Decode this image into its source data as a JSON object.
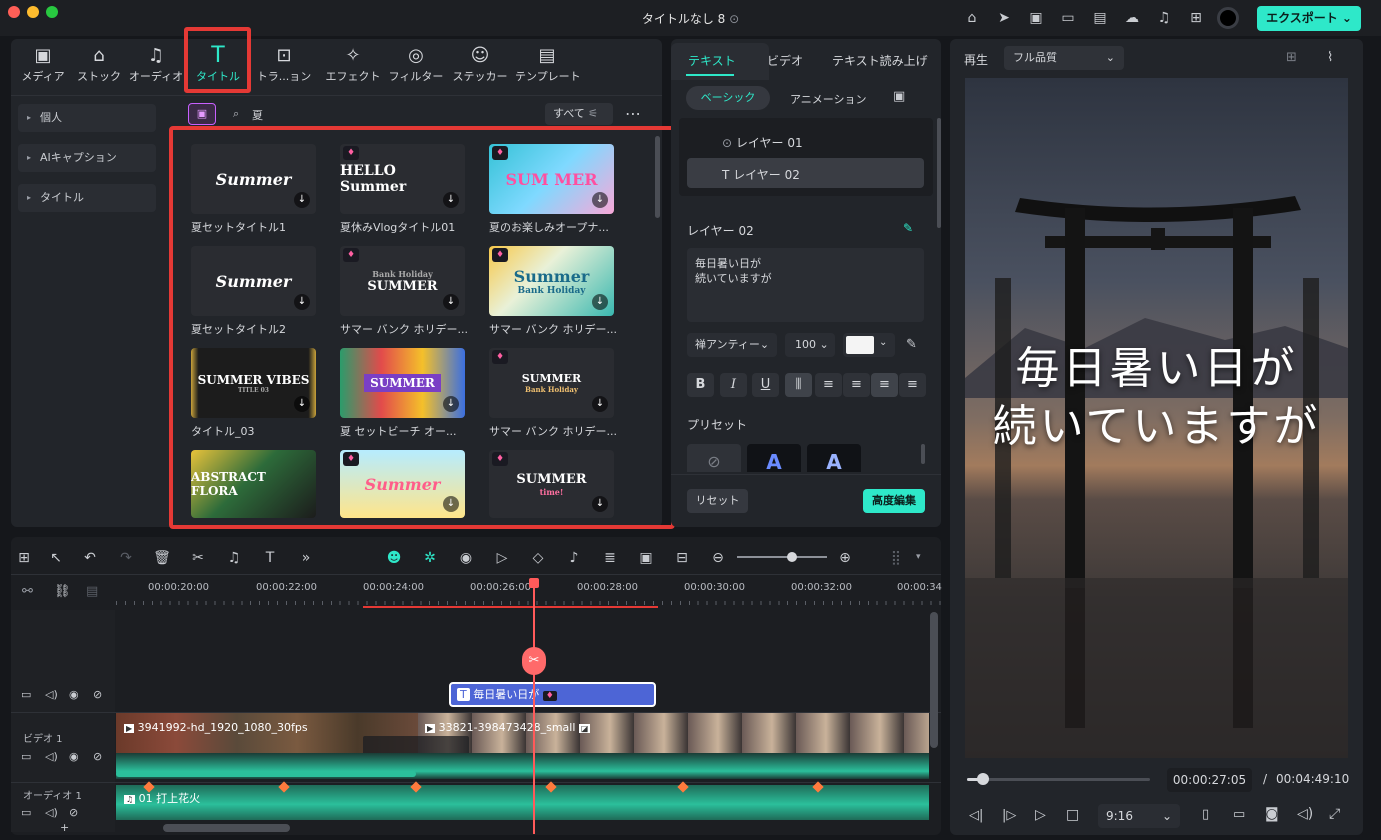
{
  "window": {
    "title": "タイトルなし 8",
    "export_label": "エクスポート"
  },
  "colors": {
    "accent": "#2ee8c9",
    "highlight_box": "#e53935",
    "title_clip": "#4d65d6",
    "audio": "#2bbf9b"
  },
  "toolbar": {
    "items": [
      {
        "label": "メディア",
        "icon": "media-icon"
      },
      {
        "label": "ストック",
        "icon": "stock-icon"
      },
      {
        "label": "オーディオ",
        "icon": "audio-icon"
      },
      {
        "label": "タイトル",
        "icon": "title-icon"
      },
      {
        "label": "トラ...ョン",
        "icon": "transition-icon"
      },
      {
        "label": "エフェクト",
        "icon": "effect-icon"
      },
      {
        "label": "フィルター",
        "icon": "filter-icon"
      },
      {
        "label": "ステッカー",
        "icon": "sticker-icon"
      },
      {
        "label": "テンプレート",
        "icon": "template-icon"
      }
    ]
  },
  "sidebar": {
    "items": [
      {
        "label": "個人"
      },
      {
        "label": "AIキャプション"
      },
      {
        "label": "タイトル"
      }
    ]
  },
  "library": {
    "search_value": "夏",
    "filter_label": "すべて",
    "thumbnails": [
      {
        "label": "夏セットタイトル1",
        "text": "Summer"
      },
      {
        "label": "夏休みVlogタイトル01",
        "text": "HELLO Summer"
      },
      {
        "label": "夏のお楽しみオープナ...",
        "text": "SUM MER"
      },
      {
        "label": "夏セットタイトル2",
        "text": "Summer"
      },
      {
        "label": "サマー バンク ホリデー...",
        "text": "SUMMER",
        "subtext": "Bank Holiday"
      },
      {
        "label": "サマー バンク ホリデー...",
        "text": "Summer",
        "subtext": "Bank Holiday"
      },
      {
        "label": "タイトル_03",
        "text": "SUMMER VIBES",
        "subtext": "TITLE 03"
      },
      {
        "label": "夏 セットビーチ オー...",
        "text": "SUMMER"
      },
      {
        "label": "サマー バンク ホリデー...",
        "text": "SUMMER",
        "subtext": "Bank Holiday"
      },
      {
        "label": "",
        "text": "ABSTRACT FLORA"
      },
      {
        "label": "",
        "text": "Summer"
      },
      {
        "label": "",
        "text": "SUMMER",
        "subtext": "time!"
      }
    ]
  },
  "props": {
    "tabs": [
      "テキスト",
      "ビデオ",
      "テキスト読み上げ"
    ],
    "subtabs": [
      "ベーシック",
      "アニメーション"
    ],
    "layers": [
      "レイヤー 01",
      "レイヤー 02"
    ],
    "section_title": "レイヤー 02",
    "text_line1": "毎日暑い日が",
    "text_line2": "続いていますが",
    "font": "禅アンティー",
    "size": "100",
    "preset_label": "プリセット",
    "reset_label": "リセット",
    "advanced_label": "高度編集"
  },
  "preview": {
    "play_label": "再生",
    "quality": "フル品質",
    "caption_line1": "毎日暑い日が",
    "caption_line2": "続いていますが",
    "current_time": "00:00:27:05",
    "separator": "/",
    "total_time": "00:04:49:10",
    "aspect": "9:16",
    "progress": 0.09
  },
  "timeline": {
    "ruler": [
      "00:00:20:00",
      "00:00:22:00",
      "00:00:24:00",
      "00:00:26:00",
      "00:00:28:00",
      "00:00:30:00",
      "00:00:32:00",
      "00:00:34"
    ],
    "title_clip": "毎日暑い日が",
    "video_track_label": "ビデオ 1",
    "audio_track_label": "オーディオ 1",
    "clip1_name": "3941992-hd_1920_1080_30fps",
    "clip2_name": "33821-398473428_small",
    "audio_clip_name": "01 打上花火"
  }
}
